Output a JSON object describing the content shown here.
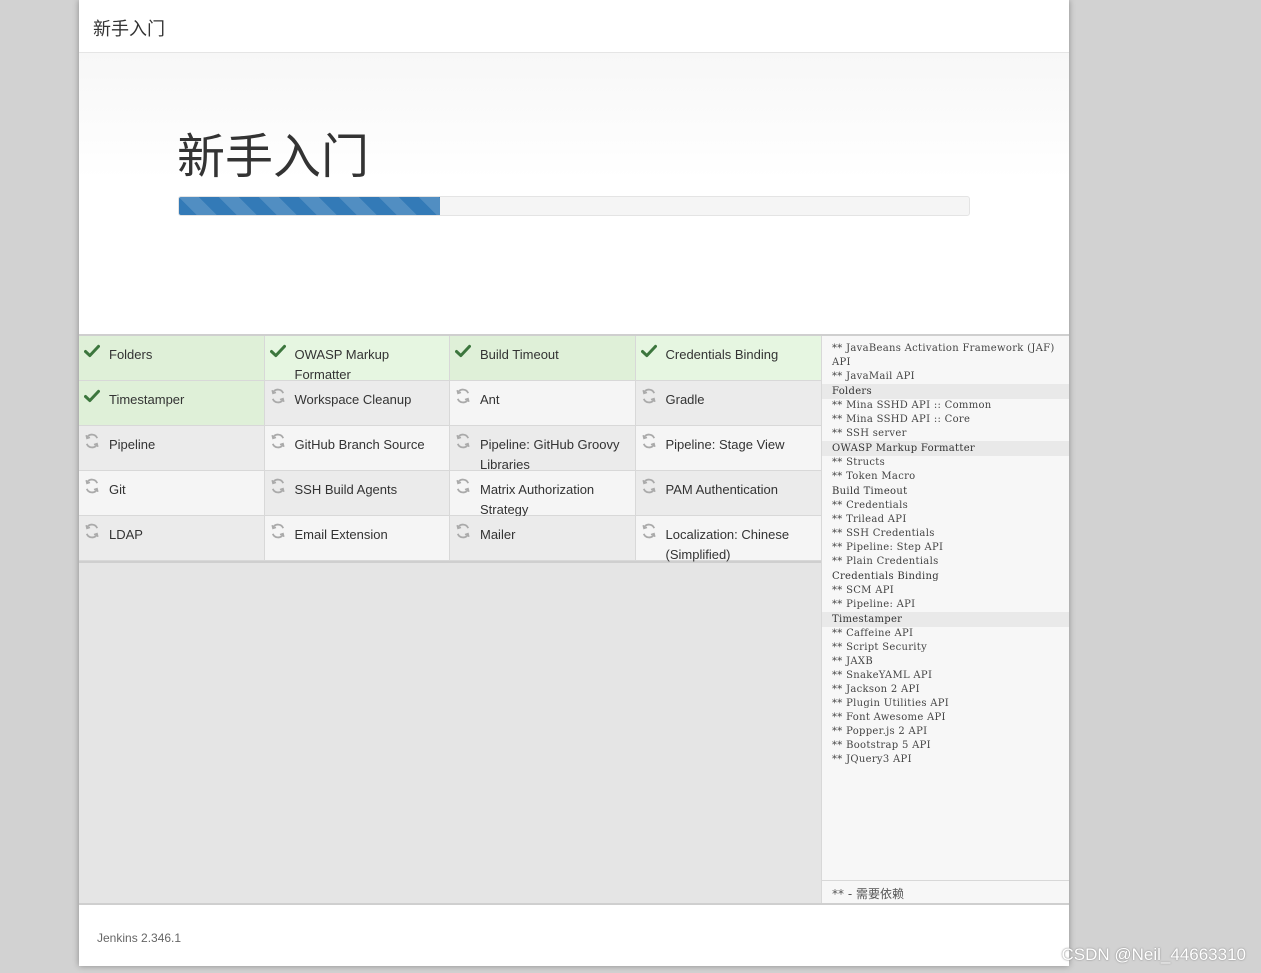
{
  "dialog": {
    "title": "新手入门"
  },
  "hero": {
    "title": "新手入门",
    "progress_percent": 33,
    "progress_color": "#337ab7"
  },
  "plugins": {
    "colors": {
      "installed": "#dff0d8",
      "pending": "#f5f5f5",
      "check": "#3c763d",
      "spinner": "#aaaaaa"
    },
    "rows": [
      [
        {
          "name": "Folders",
          "status": "installed"
        },
        {
          "name": "OWASP Markup Formatter",
          "status": "installed"
        },
        {
          "name": "Build Timeout",
          "status": "installed"
        },
        {
          "name": "Credentials Binding",
          "status": "installed"
        }
      ],
      [
        {
          "name": "Timestamper",
          "status": "installed"
        },
        {
          "name": "Workspace Cleanup",
          "status": "pending"
        },
        {
          "name": "Ant",
          "status": "pending"
        },
        {
          "name": "Gradle",
          "status": "pending"
        }
      ],
      [
        {
          "name": "Pipeline",
          "status": "pending"
        },
        {
          "name": "GitHub Branch Source",
          "status": "pending"
        },
        {
          "name": "Pipeline: GitHub Groovy Libraries",
          "status": "pending"
        },
        {
          "name": "Pipeline: Stage View",
          "status": "pending"
        }
      ],
      [
        {
          "name": "Git",
          "status": "pending"
        },
        {
          "name": "SSH Build Agents",
          "status": "pending"
        },
        {
          "name": "Matrix Authorization Strategy",
          "status": "pending"
        },
        {
          "name": "PAM Authentication",
          "status": "pending"
        }
      ],
      [
        {
          "name": "LDAP",
          "status": "pending"
        },
        {
          "name": "Email Extension",
          "status": "pending"
        },
        {
          "name": "Mailer",
          "status": "pending"
        },
        {
          "name": "Localization: Chinese (Simplified)",
          "status": "pending"
        }
      ]
    ]
  },
  "log": {
    "lines": [
      {
        "text": "** JavaBeans Activation Framework (JAF) API",
        "kind": "dep"
      },
      {
        "text": "** JavaMail API",
        "kind": "dep"
      },
      {
        "text": "Folders",
        "kind": "head",
        "highlight": true
      },
      {
        "text": "** Mina SSHD API :: Common",
        "kind": "dep"
      },
      {
        "text": "** Mina SSHD API :: Core",
        "kind": "dep"
      },
      {
        "text": "** SSH server",
        "kind": "dep"
      },
      {
        "text": "OWASP Markup Formatter",
        "kind": "head",
        "highlight": true
      },
      {
        "text": "** Structs",
        "kind": "dep"
      },
      {
        "text": "** Token Macro",
        "kind": "dep"
      },
      {
        "text": "Build Timeout",
        "kind": "head",
        "highlight": false
      },
      {
        "text": "** Credentials",
        "kind": "dep"
      },
      {
        "text": "** Trilead API",
        "kind": "dep"
      },
      {
        "text": "** SSH Credentials",
        "kind": "dep"
      },
      {
        "text": "** Pipeline: Step API",
        "kind": "dep"
      },
      {
        "text": "** Plain Credentials",
        "kind": "dep"
      },
      {
        "text": "Credentials Binding",
        "kind": "head",
        "highlight": false
      },
      {
        "text": "** SCM API",
        "kind": "dep"
      },
      {
        "text": "** Pipeline: API",
        "kind": "dep"
      },
      {
        "text": "Timestamper",
        "kind": "head",
        "highlight": true
      },
      {
        "text": "** Caffeine API",
        "kind": "dep"
      },
      {
        "text": "** Script Security",
        "kind": "dep"
      },
      {
        "text": "** JAXB",
        "kind": "dep"
      },
      {
        "text": "** SnakeYAML API",
        "kind": "dep"
      },
      {
        "text": "** Jackson 2 API",
        "kind": "dep"
      },
      {
        "text": "** Plugin Utilities API",
        "kind": "dep"
      },
      {
        "text": "** Font Awesome API",
        "kind": "dep"
      },
      {
        "text": "** Popper.js 2 API",
        "kind": "dep"
      },
      {
        "text": "** Bootstrap 5 API",
        "kind": "dep"
      },
      {
        "text": "** JQuery3 API",
        "kind": "dep"
      }
    ],
    "legend": "** - 需要依赖"
  },
  "footer": {
    "version": "Jenkins 2.346.1"
  },
  "watermark": "CSDN @Neil_44663310"
}
